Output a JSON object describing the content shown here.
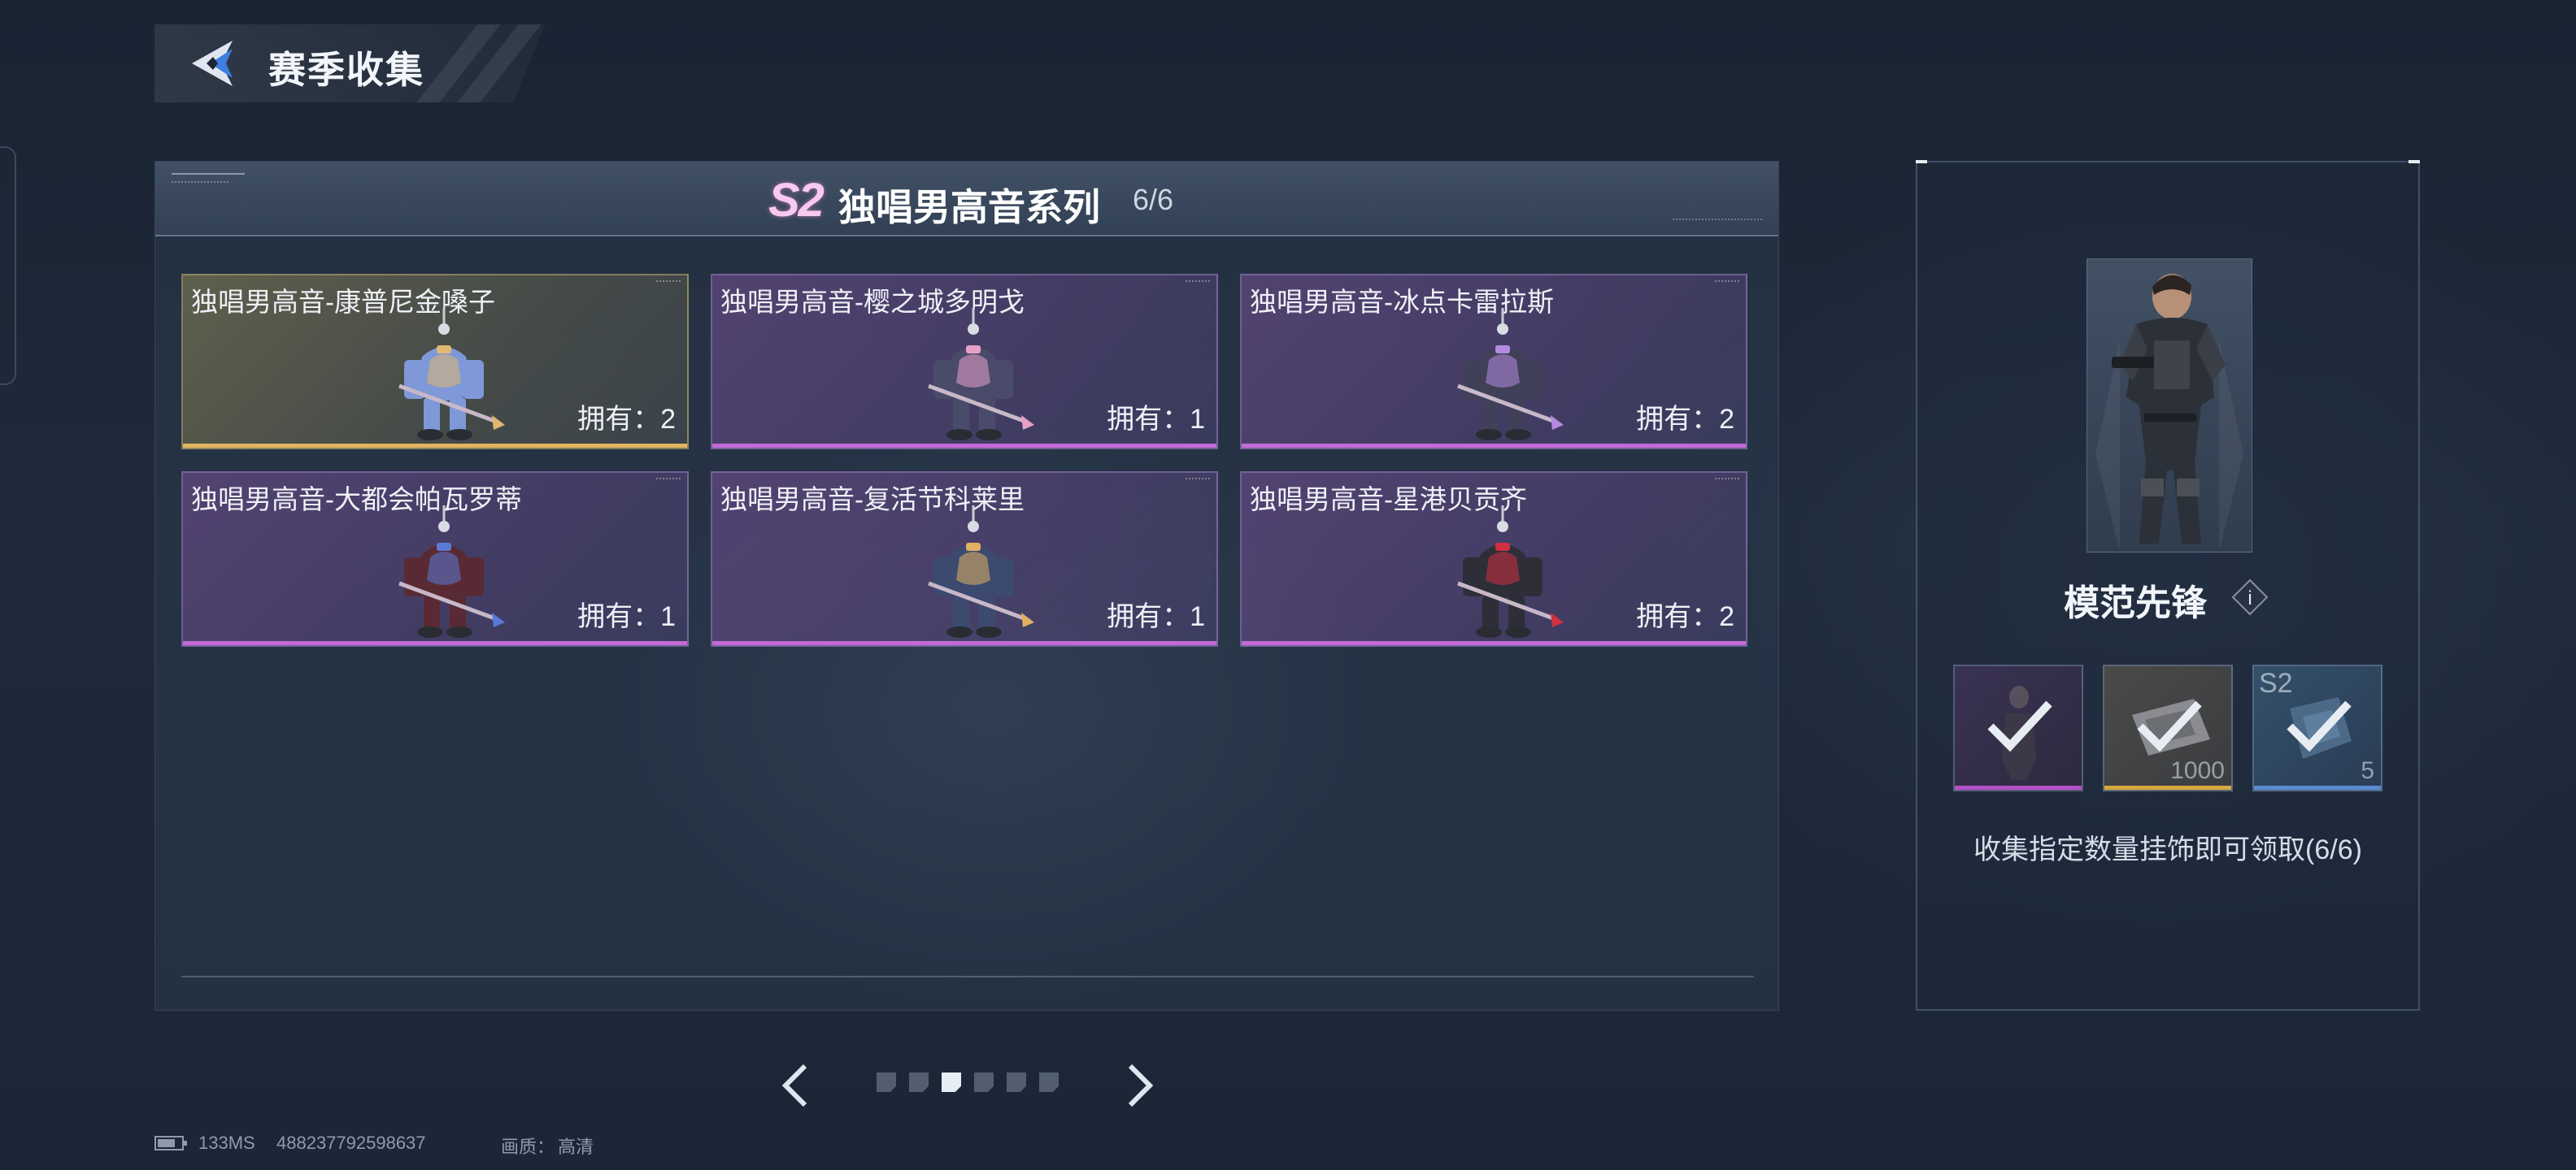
{
  "header": {
    "title": "赛季收集",
    "back_icon": "back-arrow-icon"
  },
  "series": {
    "badge": "S2",
    "name": "独唱男高音系列",
    "progress": "6/6"
  },
  "items": [
    {
      "name": "独唱男高音-康普尼金嗓子",
      "owned": "拥有：2",
      "rarity": "gold",
      "body_color": "#7f98d8",
      "accent_color": "#e0b870"
    },
    {
      "name": "独唱男高音-樱之城多明戈",
      "owned": "拥有：1",
      "rarity": "purple",
      "body_color": "#4a4a6a",
      "accent_color": "#e8a0c8"
    },
    {
      "name": "独唱男高音-冰点卡雷拉斯",
      "owned": "拥有：2",
      "rarity": "purple",
      "body_color": "#404058",
      "accent_color": "#b48be0"
    },
    {
      "name": "独唱男高音-大都会帕瓦罗蒂",
      "owned": "拥有：1",
      "rarity": "purple",
      "body_color": "#5a2a34",
      "accent_color": "#5a7ad8"
    },
    {
      "name": "独唱男高音-复活节科莱里",
      "owned": "拥有：1",
      "rarity": "purple",
      "body_color": "#3c4a70",
      "accent_color": "#e0b060"
    },
    {
      "name": "独唱男高音-星港贝贡齐",
      "owned": "拥有：2",
      "rarity": "purple",
      "body_color": "#2e2e38",
      "accent_color": "#d03040"
    }
  ],
  "pager": {
    "prev_icon": "chevron-left-icon",
    "next_icon": "chevron-right-icon",
    "page_count": 6,
    "current_page": 3
  },
  "reward": {
    "name": "模范先锋",
    "info_label": "i",
    "slots": [
      {
        "icon": "figure-icon",
        "quantity": "",
        "tag": "",
        "claimed": true,
        "color": "#b450c8"
      },
      {
        "icon": "currency-card-icon",
        "quantity": "1000",
        "tag": "",
        "claimed": true,
        "color": "#d8a840"
      },
      {
        "icon": "ornament-box-icon",
        "quantity": "5",
        "tag": "S2",
        "claimed": true,
        "color": "#5a8ad0"
      }
    ],
    "description": "收集指定数量挂饰即可领取(6/6)"
  },
  "status_bar": {
    "battery_level": 0.75,
    "latency": "133MS",
    "player_id": "488237792598637",
    "quality_label": "画质：",
    "quality_value": "高清"
  },
  "colors": {
    "gold_rarity": "#e3b460",
    "purple_rarity": "#c46ad8",
    "season_badge": "#f7c9ec"
  }
}
